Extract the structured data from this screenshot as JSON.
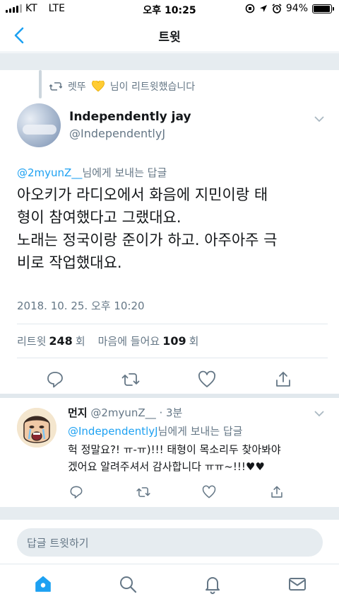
{
  "status_bar": {
    "carrier": "KT",
    "network": "LTE",
    "time": "오후 10:25",
    "battery": "94%",
    "battery_level": 0.94
  },
  "nav": {
    "title": "트윗"
  },
  "retweet_banner": {
    "text_before": "렛뚜",
    "text_after": "님이 리트윗했습니다"
  },
  "tweet": {
    "author_name": "Independently jay",
    "author_handle": "@IndependentlyJ",
    "reply_to_handle": "@2myunZ__",
    "reply_to_suffix": "님에게 보내는 답글",
    "text": "아오키가 라디오에서 화음에 지민이랑 태\n형이 참여했다고 그랬대요.\n노래는 정국이랑 준이가 하고. 아주아주 극\n비로 작업했대요.",
    "date": "2018. 10. 25. 오후 10:20",
    "retweet_label": "리트윗",
    "retweet_count": "248",
    "retweet_unit": "회",
    "like_label": "마음에 들어요",
    "like_count": "109",
    "like_unit": "회"
  },
  "reply": {
    "author_name": "먼지",
    "author_handle_time": "@2myunZ__ · 3분",
    "reply_to_handle": "@IndependentlyJ",
    "reply_to_suffix": "님에게 보내는 답글",
    "text": "헉 정말요?! ㅠ-ㅠ)!!! 태형이 목소리두 찾아봐야\n겠어요 알려주셔서 감사합니다 ㅠㅠ~!!!♥♥"
  },
  "compose": {
    "placeholder": "답글 트윗하기"
  },
  "colors": {
    "accent": "#1da1f2",
    "secondary_text": "#657786",
    "divider": "#e1e8ed",
    "background_gap": "#e6ecf0"
  },
  "icons": {
    "back": "chevron-left-icon",
    "retweet": "retweet-icon",
    "heart_emoji": "yellow-heart-icon",
    "more": "chevron-down-icon",
    "reply": "reply-icon",
    "like": "heart-icon",
    "share": "share-icon",
    "home": "home-icon",
    "search": "search-icon",
    "notifications": "bell-icon",
    "messages": "mail-icon"
  }
}
